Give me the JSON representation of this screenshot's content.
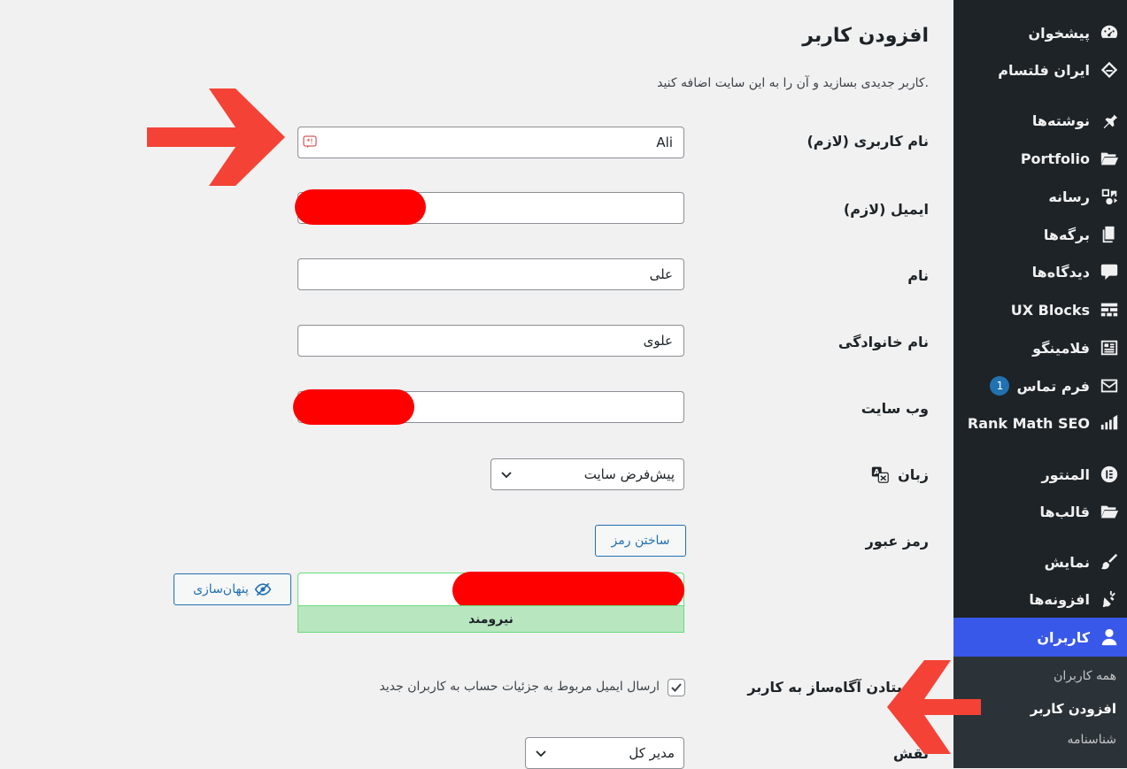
{
  "sidebar": {
    "items": [
      {
        "label": "پیشخوان",
        "icon": "dashboard-icon"
      },
      {
        "label": "ایران فلتسام",
        "icon": "diamond-logo-icon"
      },
      {
        "label": "نوشته‌ها",
        "icon": "pin-icon"
      },
      {
        "label": "Portfolio",
        "icon": "folder-open-icon"
      },
      {
        "label": "رسانه",
        "icon": "media-icon"
      },
      {
        "label": "برگه‌ها",
        "icon": "pages-icon"
      },
      {
        "label": "دیدگاه‌ها",
        "icon": "comment-icon"
      },
      {
        "label": "UX Blocks",
        "icon": "blocks-grid-icon"
      },
      {
        "label": "فلامینگو",
        "icon": "flamingo-icon"
      },
      {
        "label": "فرم تماس",
        "icon": "mail-icon",
        "badge": "1"
      },
      {
        "label": "Rank Math SEO",
        "icon": "rank-math-icon"
      },
      {
        "label": "المنتور",
        "icon": "elementor-icon"
      },
      {
        "label": "قالب‌ها",
        "icon": "folder-icon"
      },
      {
        "label": "نمایش",
        "icon": "brush-icon"
      },
      {
        "label": "افزونه‌ها",
        "icon": "plugin-icon"
      },
      {
        "label": "کاربران",
        "icon": "user-icon",
        "active": true
      }
    ],
    "submenu": [
      "همه کاربران",
      "افزودن کاربر",
      "شناسنامه"
    ]
  },
  "page": {
    "title": "افزودن کاربر",
    "description": "کاربر جدیدی بسازید و آن را به این سایت اضافه کنید."
  },
  "form": {
    "username_label": "نام کاربری (لازم)",
    "username_value": "Ali",
    "email_label": "ایمیل (لازم)",
    "first_name_label": "نام",
    "first_name_value": "علی",
    "last_name_label": "نام خانوادگی",
    "last_name_value": "علوی",
    "website_label": "وب سایت",
    "language_label": "زبان",
    "language_value": "پیش‌فرض سایت",
    "password_label": "رمز عبور",
    "generate_password_label": "ساختن رمز",
    "hide_password_label": "پنهان‌سازی",
    "strength_label": "نیرومند",
    "notify_label": "فرستادن آگاه‌ساز به کاربر",
    "notify_text": "ارسال ایمیل مربوط به جزئیات حساب به کاربران جدید",
    "role_label": "نقش",
    "role_value": "مدیر کل"
  },
  "colors": {
    "sidebar_bg": "#1d2327",
    "active_bg": "#3858e9",
    "accent": "#2271b1",
    "annotation_arrow": "#f44336",
    "redaction": "#ff0000",
    "strength_bg": "#b8e6bf"
  }
}
